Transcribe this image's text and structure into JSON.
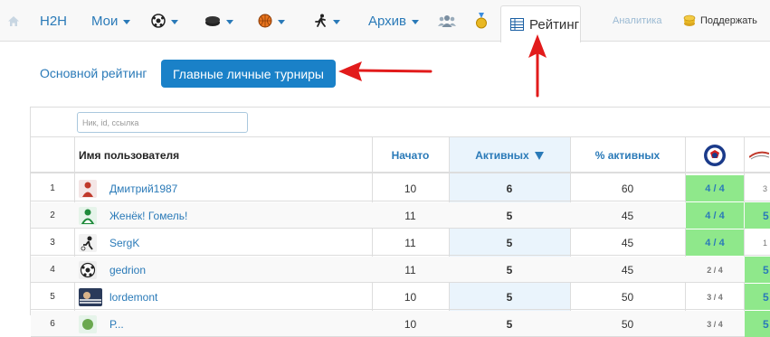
{
  "nav": {
    "h2h": "H2H",
    "mine": "Мои",
    "archive": "Архив",
    "rating": "Рейтинг",
    "analytics": "Аналитика",
    "support": "Поддержать"
  },
  "tabs": {
    "main_rating": "Основной рейтинг",
    "personal": "Главные личные турниры"
  },
  "search": {
    "placeholder": "Ник, id, ссылка"
  },
  "table": {
    "headers": {
      "user": "Имя пользователя",
      "started": "Начато",
      "active": "Активных",
      "pct_active": "% активных"
    },
    "rows": [
      {
        "num": "1",
        "name": "Дмитрий1987",
        "started": "10",
        "active": "6",
        "pct": "60",
        "ratio": "4 / 4",
        "ratio_green": true,
        "next": "3",
        "next_green": false
      },
      {
        "num": "2",
        "name": "Женёк! Гомель!",
        "started": "11",
        "active": "5",
        "pct": "45",
        "ratio": "4 / 4",
        "ratio_green": true,
        "next": "5",
        "next_green": true
      },
      {
        "num": "3",
        "name": "SergK",
        "started": "11",
        "active": "5",
        "pct": "45",
        "ratio": "4 / 4",
        "ratio_green": true,
        "next": "1",
        "next_green": false
      },
      {
        "num": "4",
        "name": "gedrion",
        "started": "11",
        "active": "5",
        "pct": "45",
        "ratio": "2 / 4",
        "ratio_green": false,
        "next": "5",
        "next_green": true
      },
      {
        "num": "5",
        "name": "lordemont",
        "started": "10",
        "active": "5",
        "pct": "50",
        "ratio": "3 / 4",
        "ratio_green": false,
        "next": "5",
        "next_green": true
      },
      {
        "num": "6",
        "name": "Р...",
        "started": "10",
        "active": "5",
        "pct": "50",
        "ratio": "3 / 4",
        "ratio_green": false,
        "next": "5",
        "next_green": true
      }
    ]
  },
  "colors": {
    "link": "#2a7ab8",
    "accent": "#1a81c8",
    "green": "#8fe88b",
    "arrow": "#e21b1b"
  }
}
